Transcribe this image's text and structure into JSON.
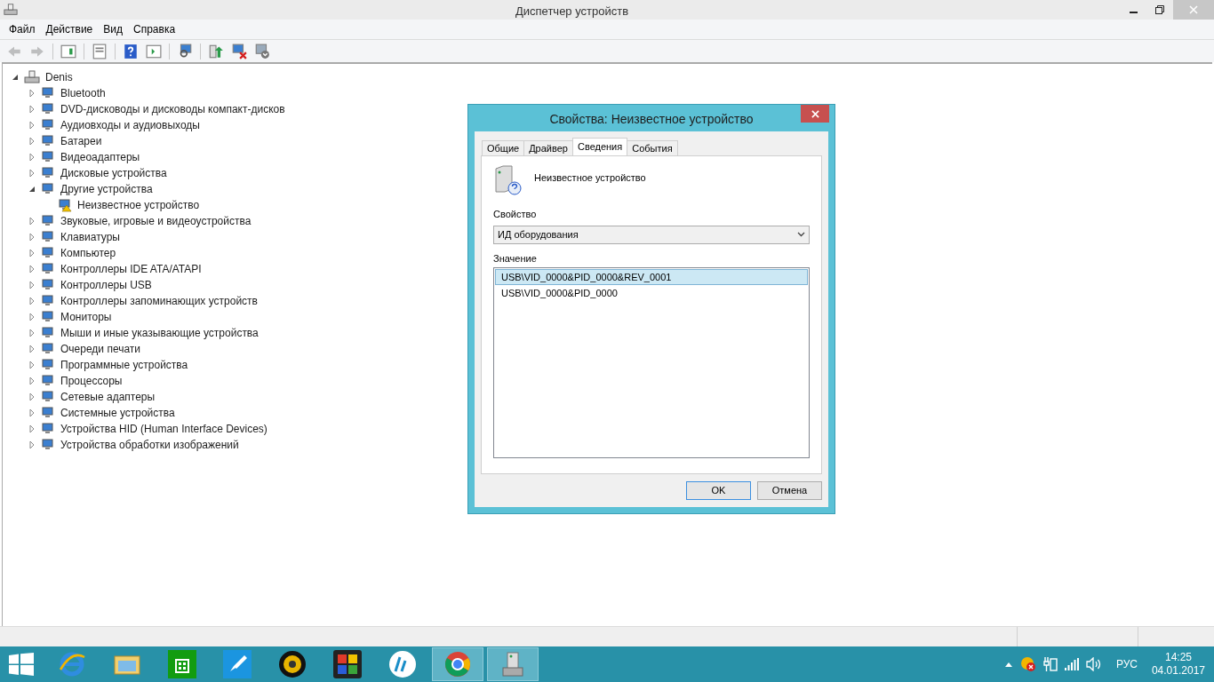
{
  "window": {
    "title": "Диспетчер устройств"
  },
  "menu": [
    "Файл",
    "Действие",
    "Вид",
    "Справка"
  ],
  "toolbar": [
    {
      "disabled": true
    },
    {
      "disabled": true
    },
    {
      "disabled": false
    },
    {
      "disabled": false
    },
    {
      "disabled": false
    },
    {
      "disabled": false
    },
    {
      "disabled": false
    },
    {
      "disabled": false
    },
    {
      "disabled": false
    },
    {
      "disabled": false
    }
  ],
  "tree": {
    "label": "Denis",
    "expanded": true,
    "children": [
      {
        "label": "Bluetooth",
        "expanded": false,
        "warning": false
      },
      {
        "label": "DVD-дисководы и дисководы компакт-дисков",
        "expanded": false,
        "warning": false
      },
      {
        "label": "Аудиовходы и аудиовыходы",
        "expanded": false,
        "warning": false
      },
      {
        "label": "Батареи",
        "expanded": false,
        "warning": false
      },
      {
        "label": "Видеоадаптеры",
        "expanded": false,
        "warning": false
      },
      {
        "label": "Дисковые устройства",
        "expanded": false,
        "warning": false
      },
      {
        "label": "Другие устройства",
        "expanded": true,
        "warning": false,
        "children": [
          {
            "label": "Неизвестное устройство",
            "warning": true
          }
        ]
      },
      {
        "label": "Звуковые, игровые и видеоустройства",
        "expanded": false,
        "warning": false
      },
      {
        "label": "Клавиатуры",
        "expanded": false,
        "warning": false
      },
      {
        "label": "Компьютер",
        "expanded": false,
        "warning": false
      },
      {
        "label": "Контроллеры IDE ATA/ATAPI",
        "expanded": false,
        "warning": false
      },
      {
        "label": "Контроллеры USB",
        "expanded": false,
        "warning": false
      },
      {
        "label": "Контроллеры запоминающих устройств",
        "expanded": false,
        "warning": false
      },
      {
        "label": "Мониторы",
        "expanded": false,
        "warning": false
      },
      {
        "label": "Мыши и иные указывающие устройства",
        "expanded": false,
        "warning": false
      },
      {
        "label": "Очереди печати",
        "expanded": false,
        "warning": false
      },
      {
        "label": "Программные устройства",
        "expanded": false,
        "warning": false
      },
      {
        "label": "Процессоры",
        "expanded": false,
        "warning": false
      },
      {
        "label": "Сетевые адаптеры",
        "expanded": false,
        "warning": false
      },
      {
        "label": "Системные устройства",
        "expanded": false,
        "warning": false
      },
      {
        "label": "Устройства HID (Human Interface Devices)",
        "expanded": false,
        "warning": false
      },
      {
        "label": "Устройства обработки изображений",
        "expanded": false,
        "warning": false
      }
    ]
  },
  "dialog": {
    "title": "Свойства: Неизвестное устройство",
    "tabs": [
      {
        "label": "Общие",
        "selected": false
      },
      {
        "label": "Драйвер",
        "selected": false
      },
      {
        "label": "Сведения",
        "selected": true
      },
      {
        "label": "События",
        "selected": false
      }
    ],
    "device_name": "Неизвестное устройство",
    "property": {
      "label": "Свойство",
      "value": "ИД оборудования"
    },
    "value": {
      "label": "Значение",
      "rows": [
        {
          "text": "USB\\VID_0000&PID_0000&REV_0001",
          "selected": true
        },
        {
          "text": "USB\\VID_0000&PID_0000",
          "selected": false
        }
      ]
    },
    "buttons": [
      {
        "label": "OK",
        "focused": true
      },
      {
        "label": "Отмена",
        "focused": false
      }
    ]
  },
  "taskbar": {
    "apps": [
      {
        "running": false
      },
      {
        "running": false
      },
      {
        "running": false
      },
      {
        "running": false
      },
      {
        "running": false
      },
      {
        "running": false
      },
      {
        "running": false
      },
      {
        "running": true
      },
      {
        "running": true
      }
    ],
    "language": "РУС",
    "time": "14:25",
    "date": "04.01.2017"
  }
}
